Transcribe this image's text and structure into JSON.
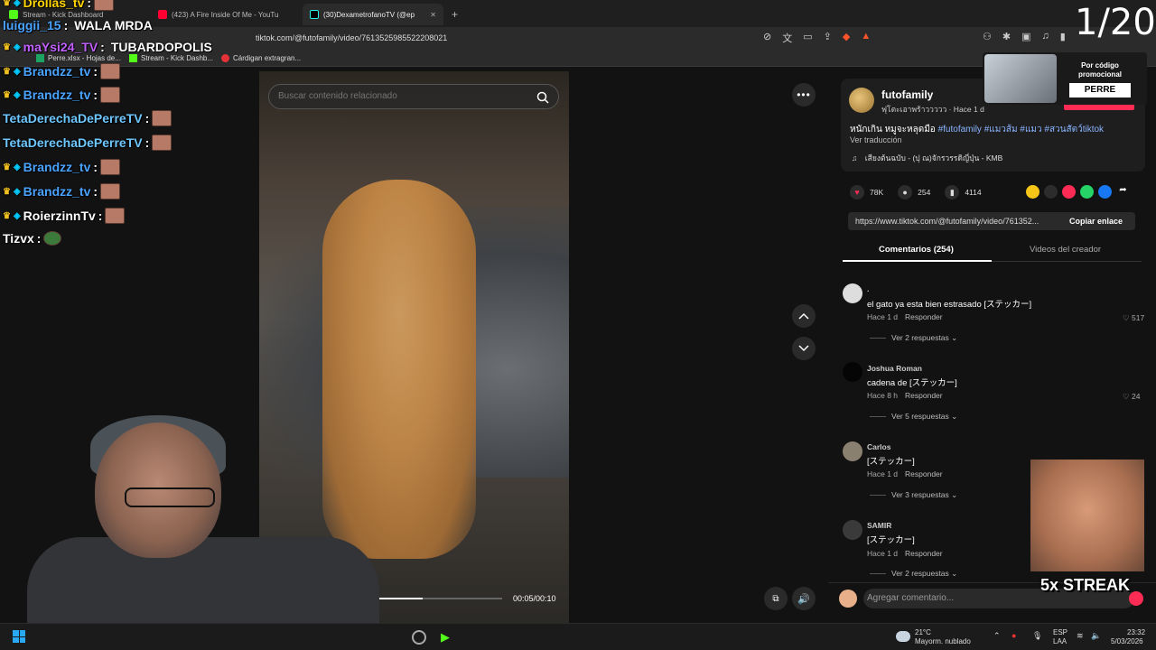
{
  "browser": {
    "tabs": [
      {
        "label": "Stream - Kick Dashboard",
        "active": false
      },
      {
        "label": "(423) A Fire Inside Of Me - YouTu",
        "active": false
      },
      {
        "label": "(30)DexametrofanoTV (@ep",
        "active": true
      }
    ],
    "url": "tiktok.com/@futofamily/video/7613525985522208021",
    "bookmarks": [
      "Perre.xlsx - Hojas de...",
      "Stream - Kick Dashb...",
      "Cárdigan extragran..."
    ]
  },
  "video": {
    "search_placeholder": "Buscar contenido relacionado",
    "time": "00:05/00:10",
    "progress": 0.5
  },
  "post": {
    "author": "futofamily",
    "subtitle": "ฟุโตะเอาพร้าววววว · Hace 1 d",
    "caption_text": "หนักเกิน หมูจะหลุดมือ",
    "hashtags": "#futofamily #แมวส้ม #แมว #สวนสัตว์tiktok",
    "translate": "Ver traducción",
    "music": "เสียงต้นฉบับ - (ปุ ณ)จักรวรรดิญี่ปุ่น - KMB",
    "likes": "78K",
    "comments": "254",
    "saves": "4114",
    "link": "https://www.tiktok.com/@futofamily/video/761352...",
    "copy_link": "Copiar enlace"
  },
  "tabs": {
    "comments": "Comentarios (254)",
    "creator_videos": "Videos del creador"
  },
  "comments": [
    {
      "user": ".",
      "text": "el gato ya esta bien estrasado [ステッカー]",
      "meta": "Hace 1 d",
      "reply": "Responder",
      "likes": "517",
      "replies": "Ver 2 respuestas"
    },
    {
      "user": "Joshua Roman",
      "text": "cadena de [ステッカー]",
      "meta": "Hace 8 h",
      "reply": "Responder",
      "likes": "24",
      "replies": "Ver 5 respuestas"
    },
    {
      "user": "Carlos",
      "text": "[ステッカー]",
      "meta": "Hace 1 d",
      "reply": "Responder",
      "likes": "",
      "replies": "Ver 3 respuestas"
    },
    {
      "user": "SAMIR",
      "text": "[ステッカー]",
      "meta": "Hace 1 d",
      "reply": "Responder",
      "likes": "",
      "replies": "Ver 2 respuestas"
    }
  ],
  "add_comment_placeholder": "Agregar comentario...",
  "stream": {
    "counter": "1/20",
    "promo_title": "Por código promocional",
    "promo_code": "PERRE",
    "streak": "5x STREAK",
    "chat": [
      {
        "user": "Drollas_tv",
        "color": "#ffd400",
        "msg": ""
      },
      {
        "user": "luiggii_15",
        "color": "#4aa3ff",
        "msg": "WALA MRDA"
      },
      {
        "user": "maYsi24_TV",
        "color": "#c060ff",
        "msg": "TUBARDOPOLIS"
      },
      {
        "user": "Brandzz_tv",
        "color": "#4aa3ff",
        "msg": ""
      },
      {
        "user": "Brandzz_tv",
        "color": "#4aa3ff",
        "msg": ""
      },
      {
        "user": "TetaDerechaDePerreTV",
        "color": "#6ec7ff",
        "msg": ""
      },
      {
        "user": "TetaDerechaDePerreTV",
        "color": "#6ec7ff",
        "msg": ""
      },
      {
        "user": "Brandzz_tv",
        "color": "#4aa3ff",
        "msg": ""
      },
      {
        "user": "Brandzz_tv",
        "color": "#4aa3ff",
        "msg": ""
      },
      {
        "user": "RoierzinnTv",
        "color": "#ffffff",
        "msg": ""
      },
      {
        "user": "Tizvx",
        "color": "#ffffff",
        "msg": ""
      }
    ]
  },
  "taskbar": {
    "temp": "21°C",
    "weather": "Mayorm. nublado",
    "lang1": "ESP",
    "lang2": "LAA",
    "time": "23:32",
    "date": "5/03/2026"
  }
}
